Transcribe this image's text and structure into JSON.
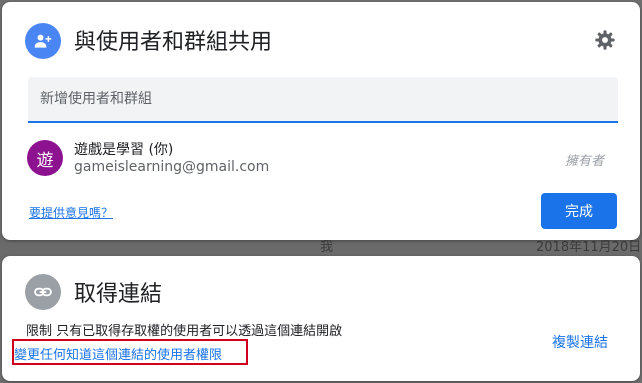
{
  "background": {
    "ghost_left": "我",
    "ghost_right": "2018年11月20日"
  },
  "share": {
    "title": "與使用者和群組共用",
    "icon": "person-add-icon",
    "settings_icon": "gear-icon",
    "input_placeholder": "新增使用者和群組",
    "input_value": "",
    "user": {
      "avatar_letter": "遊",
      "name": "遊戲是學習 (你)",
      "email": "gameislearning@gmail.com",
      "role": "擁有者"
    },
    "feedback_label": "要提供意見嗎？",
    "done_label": "完成"
  },
  "link": {
    "title": "取得連結",
    "icon": "link-icon",
    "description": "限制 只有已取得存取權的使用者可以透過這個連結開啟",
    "change_label": "變更任何知道這個連結的使用者權限",
    "copy_label": "複製連結"
  },
  "colors": {
    "accent": "#1a73e8",
    "share_icon_bg": "#4a85f4",
    "avatar_bg": "#8d128f",
    "link_icon_bg": "#9aa0a6",
    "highlight_border": "#d0021b"
  }
}
